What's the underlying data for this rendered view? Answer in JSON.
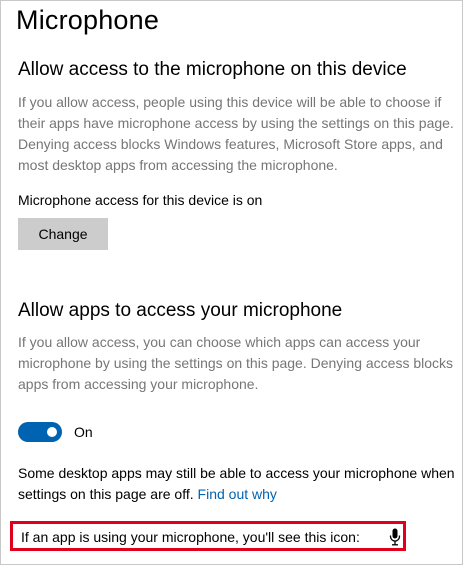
{
  "page": {
    "title": "Microphone"
  },
  "device_section": {
    "heading": "Allow access to the microphone on this device",
    "description": "If you allow access, people using this device will be able to choose if their apps have microphone access by using the settings on this page. Denying access blocks Windows features, Microsoft Store apps, and most desktop apps from accessing the microphone.",
    "status": "Microphone access for this device is on",
    "change_button_label": "Change"
  },
  "apps_section": {
    "heading": "Allow apps to access your microphone",
    "description": "If you allow access, you can choose which apps can access your microphone by using the settings on this page. Denying access blocks apps from accessing your microphone.",
    "toggle_state": "On",
    "toggle_on": true,
    "accent_color": "#0063b1"
  },
  "desktop_note": {
    "text": "Some desktop apps may still be able to access your microphone when settings on this page are off.",
    "link_label": "Find out why"
  },
  "icon_note": {
    "text": "If an app is using your microphone, you'll see this icon:",
    "icon": "microphone-icon",
    "highlight_color": "#e0001b"
  }
}
